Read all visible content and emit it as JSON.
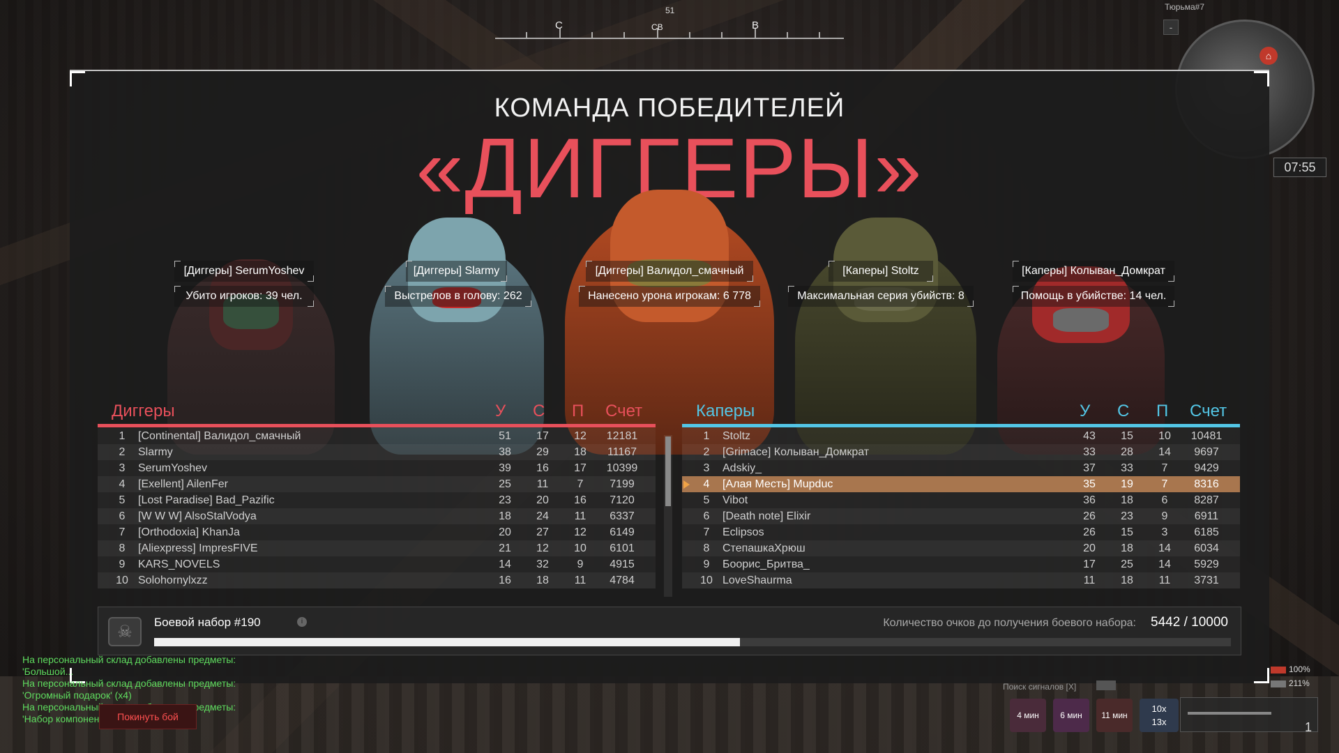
{
  "compass": {
    "bearing": "51",
    "left_dir": "С",
    "center_dir": "СВ",
    "right_dir": "В"
  },
  "minimap": {
    "location": "Тюрьма#7",
    "zoom_out": "-",
    "home_icon": "home-icon"
  },
  "timer": "07:55",
  "winner": {
    "subtitle": "КОМАНДА ПОБЕДИТЕЛЕЙ",
    "team": "«ДИГГЕРЫ»"
  },
  "highlights": [
    {
      "player": "[Диггеры] SerumYoshev",
      "stat": "Убито игроков: 39 чел."
    },
    {
      "player": "[Диггеры] Slarmy",
      "stat": "Выстрелов в голову: 262"
    },
    {
      "player": "[Диггеры] Валидол_смачный",
      "stat": "Нанесено урона игрокам: 6 778"
    },
    {
      "player": "[Каперы] Stoltz",
      "stat": "Максимальная серия убийств: 8"
    },
    {
      "player": "[Каперы] Колыван_Домкрат",
      "stat": "Помощь в убийстве: 14 чел."
    }
  ],
  "columns": {
    "kills": "У",
    "deaths": "С",
    "assists": "П",
    "score": "Счет"
  },
  "team_left": {
    "name": "Диггеры",
    "color": "#e8505b",
    "rows": [
      {
        "rank": "1",
        "name": "[Continental] Валидол_смачный",
        "k": "51",
        "d": "17",
        "a": "12",
        "score": "12181"
      },
      {
        "rank": "2",
        "name": "Slarmy",
        "k": "38",
        "d": "29",
        "a": "18",
        "score": "11167"
      },
      {
        "rank": "3",
        "name": "SerumYoshev",
        "k": "39",
        "d": "16",
        "a": "17",
        "score": "10399"
      },
      {
        "rank": "4",
        "name": "[Exellent] AilenFer",
        "k": "25",
        "d": "11",
        "a": "7",
        "score": "7199"
      },
      {
        "rank": "5",
        "name": "[Lost Paradise] Bad_Pazific",
        "k": "23",
        "d": "20",
        "a": "16",
        "score": "7120"
      },
      {
        "rank": "6",
        "name": "[W W W] AlsoStalVodya",
        "k": "18",
        "d": "24",
        "a": "11",
        "score": "6337"
      },
      {
        "rank": "7",
        "name": "[Orthodoxia] KhanJa",
        "k": "20",
        "d": "27",
        "a": "12",
        "score": "6149"
      },
      {
        "rank": "8",
        "name": "[Aliexpress] ImpresFIVE",
        "k": "21",
        "d": "12",
        "a": "10",
        "score": "6101"
      },
      {
        "rank": "9",
        "name": "KARS_NOVELS",
        "k": "14",
        "d": "32",
        "a": "9",
        "score": "4915"
      },
      {
        "rank": "10",
        "name": "Solohornylxzz",
        "k": "16",
        "d": "18",
        "a": "11",
        "score": "4784"
      }
    ]
  },
  "team_right": {
    "name": "Каперы",
    "color": "#53c6e6",
    "rows": [
      {
        "rank": "1",
        "name": "Stoltz",
        "k": "43",
        "d": "15",
        "a": "10",
        "score": "10481"
      },
      {
        "rank": "2",
        "name": "[Grimace] Колыван_Домкрат",
        "k": "33",
        "d": "28",
        "a": "14",
        "score": "9697"
      },
      {
        "rank": "3",
        "name": "Adskiy_",
        "k": "37",
        "d": "33",
        "a": "7",
        "score": "9429"
      },
      {
        "rank": "4",
        "name": "[Алая Месть] Mupduc",
        "k": "35",
        "d": "19",
        "a": "7",
        "score": "8316",
        "current": true
      },
      {
        "rank": "5",
        "name": "Vibot",
        "k": "36",
        "d": "18",
        "a": "6",
        "score": "8287"
      },
      {
        "rank": "6",
        "name": "[Death note] Elixir",
        "k": "26",
        "d": "23",
        "a": "9",
        "score": "6911"
      },
      {
        "rank": "7",
        "name": "Eclipsos",
        "k": "26",
        "d": "15",
        "a": "3",
        "score": "6185"
      },
      {
        "rank": "8",
        "name": "СтепашкаХрюш",
        "k": "20",
        "d": "18",
        "a": "14",
        "score": "6034"
      },
      {
        "rank": "9",
        "name": "Боорис_Бритва_",
        "k": "17",
        "d": "25",
        "a": "14",
        "score": "5929"
      },
      {
        "rank": "10",
        "name": "LoveShaurma",
        "k": "11",
        "d": "18",
        "a": "11",
        "score": "3731"
      }
    ]
  },
  "battle_kit": {
    "title": "Боевой набор #190",
    "info_icon": "info-icon",
    "points_label": "Количество очков до получения боевого набора:",
    "points_value": "5442 / 10000",
    "progress": 0.5442
  },
  "chat": [
    "На персональный склад добавлены предметы:",
    "'Большой...",
    "На персональный склад добавлены предметы:",
    "'Огромный подарок' (x4)",
    "На персональный склад добавлены предметы:",
    "'Набор компонентов' (x1)"
  ],
  "leave_button": "Покинуть бой",
  "hud": {
    "signal_search": "Поиск сигналов [X]",
    "tiles": [
      "4 мин",
      "6 мин",
      "11 мин"
    ],
    "tile_count_top": "10x",
    "tile_count_bottom": "13x",
    "ammo": "1",
    "health": "100%",
    "armor": "211%"
  }
}
